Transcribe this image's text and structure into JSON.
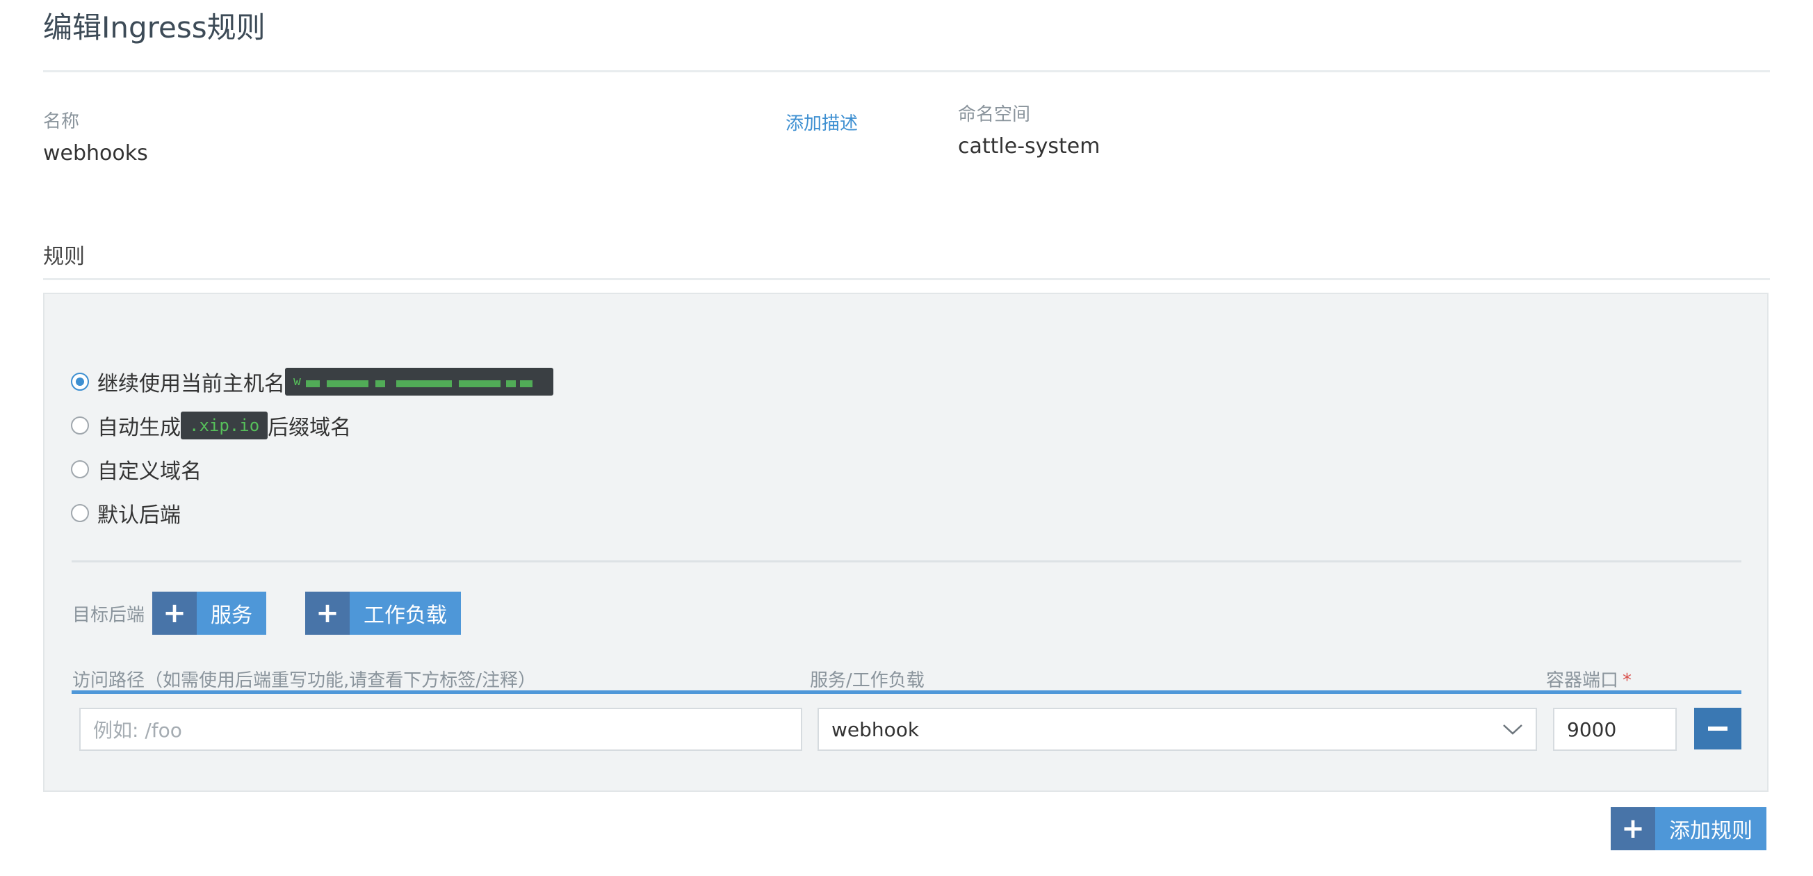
{
  "page": {
    "title": "编辑Ingress规则"
  },
  "name_field": {
    "label": "名称",
    "value": "webhooks",
    "add_description": "添加描述"
  },
  "namespace_field": {
    "label": "命名空间",
    "value": "cattle-system"
  },
  "rules_section": {
    "title": "规则"
  },
  "host_options": [
    {
      "label_prefix": "继续使用当前主机名",
      "selected": true,
      "code": "w··············"
    },
    {
      "label_prefix": "自动生成",
      "code": ".xip.io",
      "label_suffix": "后缀域名",
      "selected": false
    },
    {
      "label": "自定义域名",
      "selected": false
    },
    {
      "label": "默认后端",
      "selected": false
    }
  ],
  "target_backend": {
    "label": "目标后端",
    "service_button": "服务",
    "workload_button": "工作负载"
  },
  "columns": {
    "path": "访问路径（如需使用后端重写功能,请查看下方标签/注释）",
    "service": "服务/工作负载",
    "port": "容器端口",
    "required_mark": "*"
  },
  "rule_row": {
    "path_placeholder": "例如: /foo",
    "service_value": "webhook",
    "port_value": "9000"
  },
  "add_rule_button": "添加规则",
  "colors": {
    "accent": "#4e97d8",
    "accent_dark": "#4874a8",
    "code_bg": "#3a3f43",
    "code_text": "#56c05a",
    "required": "#d9534f"
  }
}
